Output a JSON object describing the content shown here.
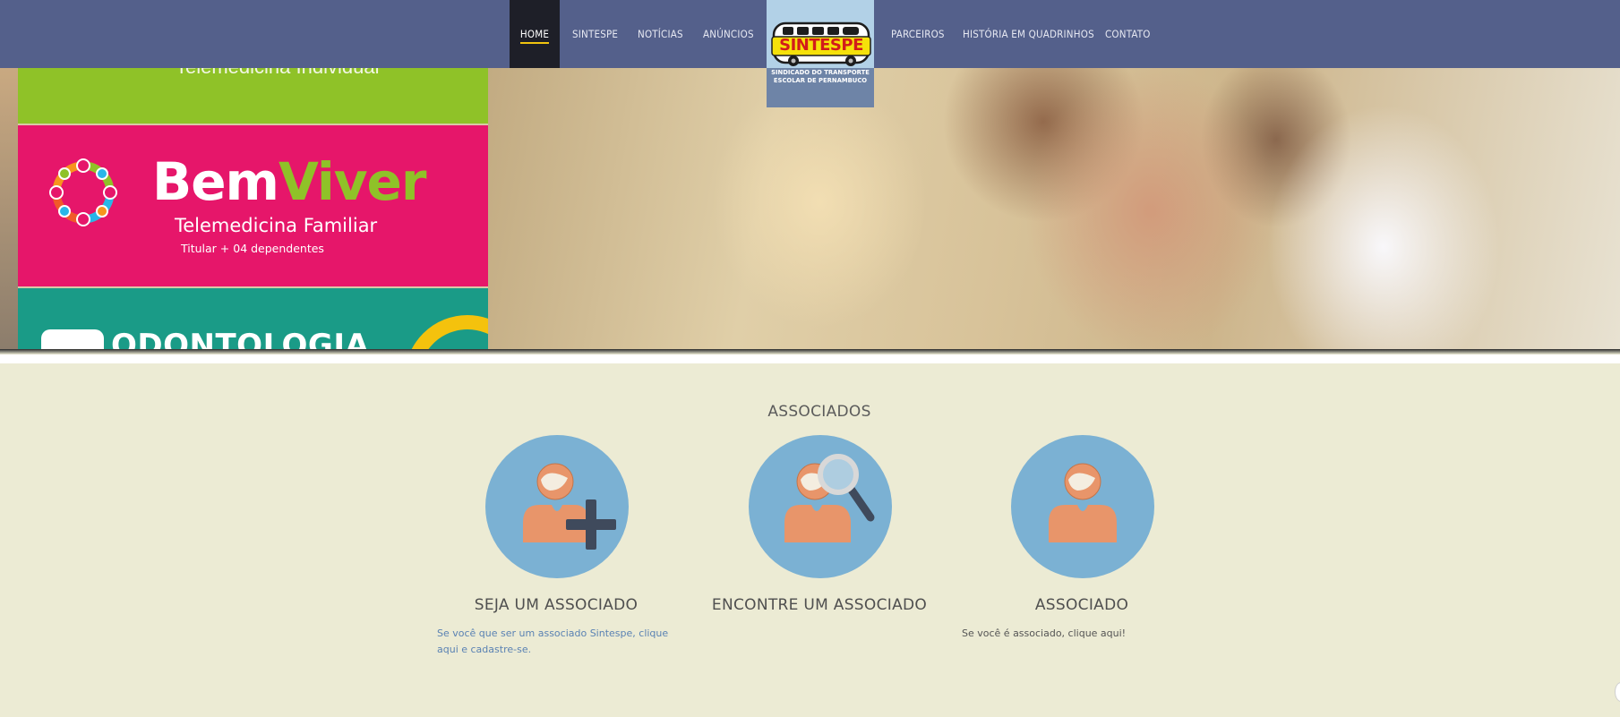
{
  "nav": {
    "items_left": [
      "HOME",
      "SINTESPE",
      "NOTÍCIAS",
      "ANÚNCIOS"
    ],
    "items_right": [
      "PARCEIROS",
      "HISTÓRIA EM QUADRINHOS",
      "CONTATO"
    ],
    "active": "HOME",
    "active_underline_color": "#f1c40f",
    "bar_color": "#54608b"
  },
  "logo": {
    "brand": "SINTESPE",
    "subtitle_line1": "SINDICADO DO TRANSPORTE",
    "subtitle_line2": "ESCOLAR DE PERNAMBUCO",
    "icon": "school-bus-icon"
  },
  "hero": {
    "green_panel_text": "Telemedicina Individual",
    "brand_part1": "Bem",
    "brand_part2": "Viver",
    "product": "Telemedicina Familiar",
    "product_detail": "Titular + 04 dependentes",
    "bottom_panel_text": "ODONTOLOGIA",
    "colors": {
      "green": "#8fc228",
      "pink": "#e6166a",
      "teal": "#1a9b87",
      "yellow": "#f4c20d"
    }
  },
  "section": {
    "title": "ASSOCIADOS",
    "background": "#ecebd4",
    "cards": [
      {
        "icon": "add-user-icon",
        "title": "SEJA UM ASSOCIADO",
        "text": "Se você que ser um associado Sintespe, clique aqui e cadastre-se."
      },
      {
        "icon": "search-user-icon",
        "title": "ENCONTRE UM ASSOCIADO",
        "text": ""
      },
      {
        "icon": "user-icon",
        "title": "ASSOCIADO",
        "text": "Se você é associado, clique aqui!"
      }
    ]
  }
}
